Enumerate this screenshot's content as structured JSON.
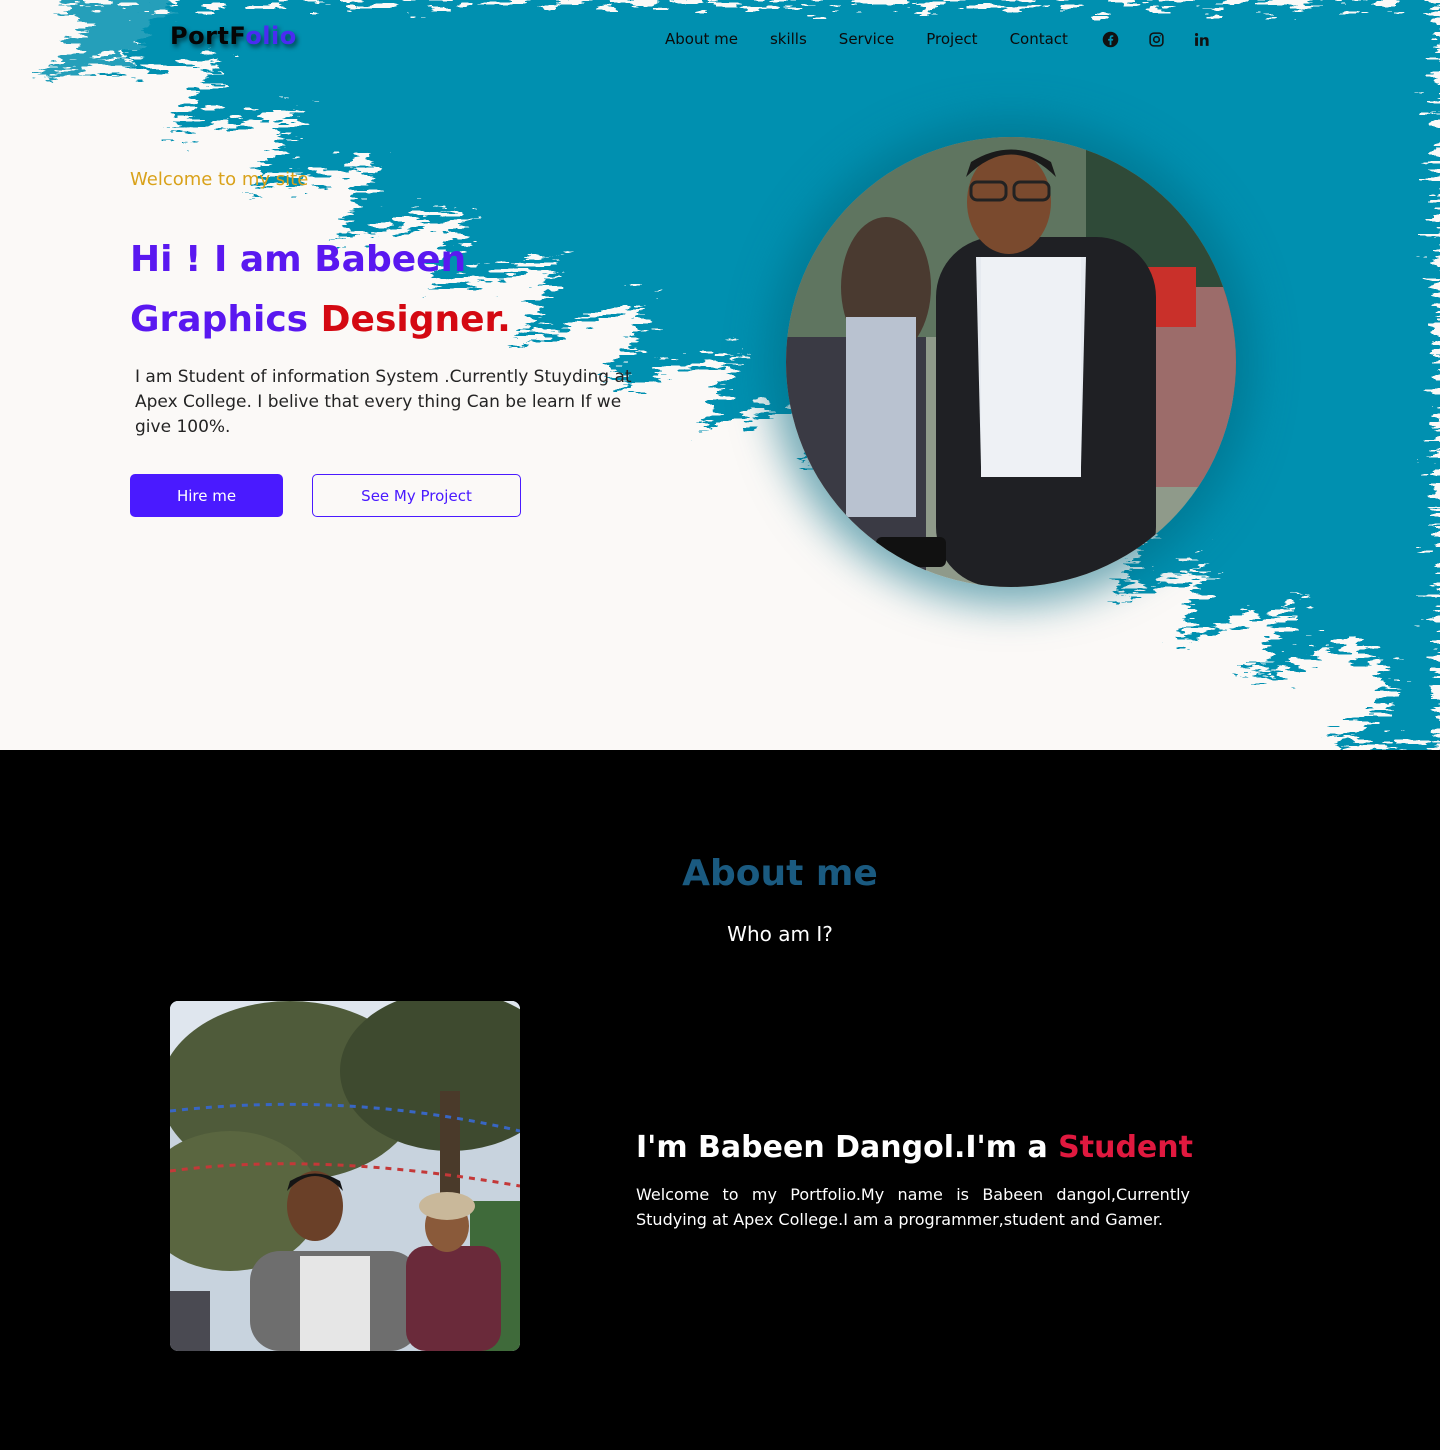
{
  "logo": {
    "part1": "PortF",
    "part2": "olio"
  },
  "nav": {
    "links": [
      "About me",
      "skills",
      "Service",
      "Project",
      "Contact"
    ]
  },
  "social": [
    "facebook-icon",
    "instagram-icon",
    "linkedin-icon"
  ],
  "hero": {
    "welcome": "Welcome to my site",
    "line1": "Hi ! I am Babeen",
    "line2_part1": "Graphics ",
    "line2_part2": "Designer.",
    "intro": "I am Student of information System .Currently Stuyding at Apex College. I belive that every thing Can be learn If we give 100%.",
    "hire_button": "Hire me",
    "project_button": "See My Project"
  },
  "about": {
    "title": "About me",
    "subtitle": "Who am I?",
    "heading_prefix": "I'm Babeen Dangol.I'm a ",
    "heading_accent": "Student",
    "text": "Welcome to my Portfolio.My name is Babeen dangol,Currently Studying at Apex College.I am a programmer,student and Gamer."
  },
  "colors": {
    "hero_teal": "#0090b0",
    "accent_purple": "#4a1aff",
    "accent_red": "#d40912",
    "welcome_gold": "#d9a21b",
    "about_title": "#1a5a80",
    "about_accent": "#e0193f"
  }
}
